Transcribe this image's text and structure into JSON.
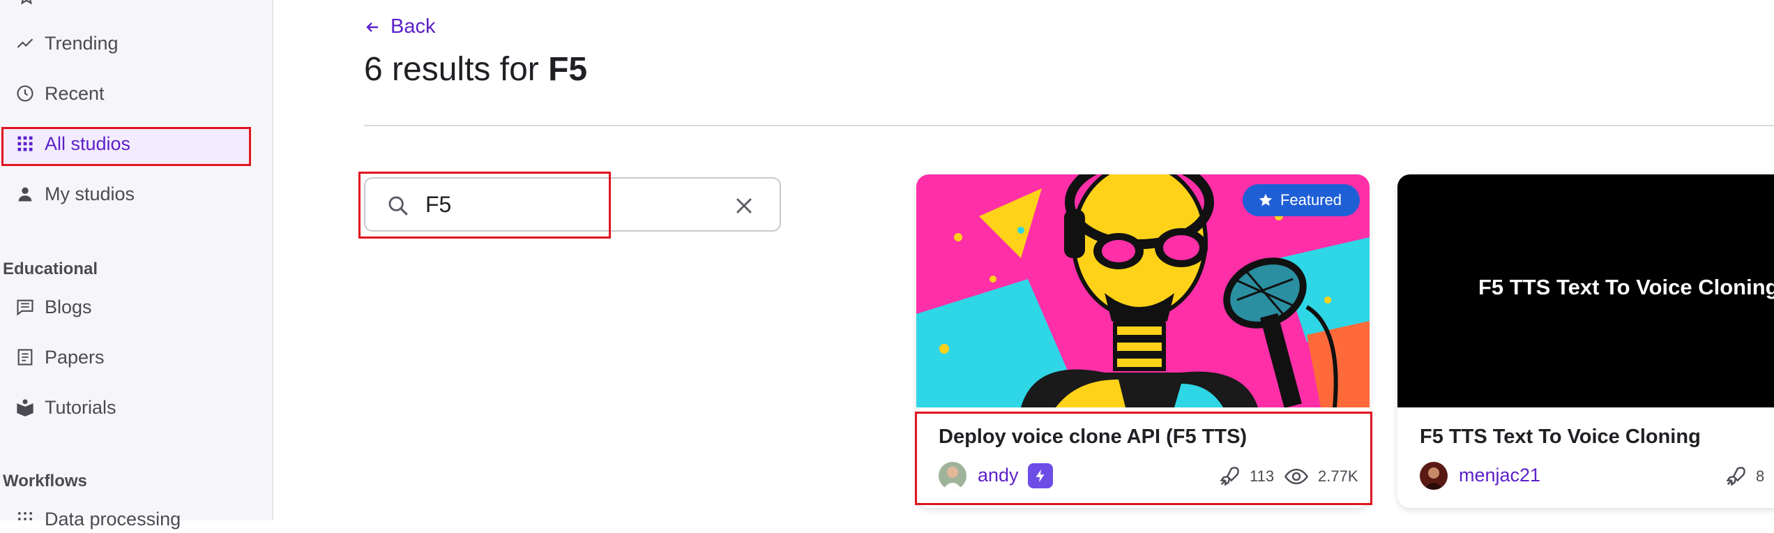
{
  "sidebar": {
    "nav": [
      {
        "label": "Trending",
        "icon": "trending-icon"
      },
      {
        "label": "Recent",
        "icon": "clock-icon"
      },
      {
        "label": "All studios",
        "icon": "grid-icon",
        "active": true
      },
      {
        "label": "My studios",
        "icon": "user-icon"
      }
    ],
    "educational_heading": "Educational",
    "educational": [
      {
        "label": "Blogs",
        "icon": "blog-icon"
      },
      {
        "label": "Papers",
        "icon": "paper-icon"
      },
      {
        "label": "Tutorials",
        "icon": "book-icon"
      }
    ],
    "workflows_heading": "Workflows",
    "workflows": [
      {
        "label": "Data processing",
        "icon": "dots-grid-icon"
      }
    ]
  },
  "header": {
    "back_label": "Back",
    "results_prefix": "6 results for",
    "query": "F5"
  },
  "search": {
    "value": "F5",
    "placeholder": ""
  },
  "cards": [
    {
      "title": "Deploy voice clone API (F5 TTS)",
      "author": "andy",
      "badge": "Featured",
      "deploys": "113",
      "views": "2.77K"
    },
    {
      "title": "F5 TTS Text To Voice Cloning",
      "thumb_text": "F5 TTS Text To Voice Cloning",
      "author": "menjac21",
      "deploys": "8"
    }
  ],
  "colors": {
    "accent": "#5b1fc9",
    "highlight": "#e0151f",
    "featured": "#1f5fd6"
  }
}
